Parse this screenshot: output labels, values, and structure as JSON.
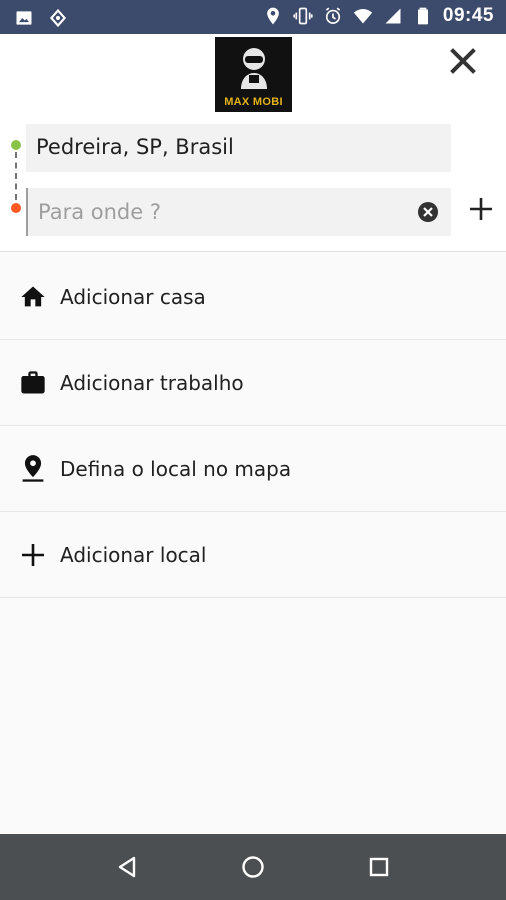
{
  "status_bar": {
    "time": "09:45",
    "icons": [
      "image-icon",
      "app-icon",
      "location-icon",
      "vibrate-icon",
      "alarm-icon",
      "wifi-icon",
      "signal-icon",
      "battery-icon"
    ]
  },
  "header": {
    "logo_text": "MAX MOBI",
    "close_icon": "close-icon"
  },
  "route": {
    "origin_value": "Pedreira, SP, Brasil",
    "destination_placeholder": "Para onde ?",
    "origin_color": "#8bc34a",
    "destination_color": "#ff5722"
  },
  "places": [
    {
      "label": "Adicionar casa",
      "icon": "home-icon"
    },
    {
      "label": "Adicionar trabalho",
      "icon": "briefcase-icon"
    },
    {
      "label": "Defina o local no mapa",
      "icon": "map-pin-icon"
    },
    {
      "label": "Adicionar local",
      "icon": "plus-icon"
    }
  ],
  "nav_bar": {
    "buttons": [
      "back-icon",
      "home-circle-icon",
      "recents-icon"
    ]
  }
}
